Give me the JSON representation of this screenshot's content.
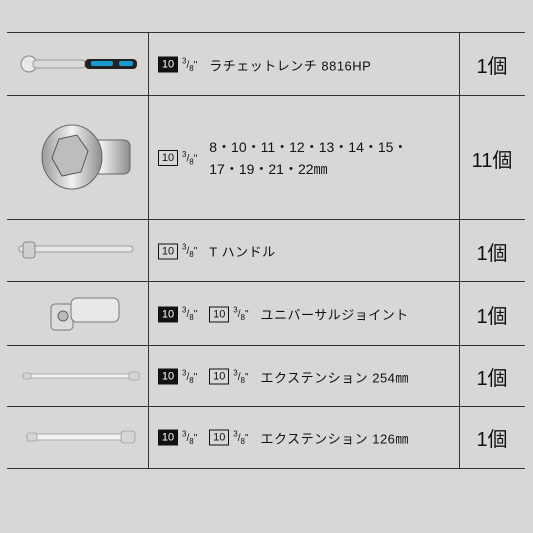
{
  "rows": [
    {
      "badges": [
        {
          "num": "10",
          "style": "solid",
          "frac_top": "3",
          "frac_bottom": "8"
        }
      ],
      "text": "ラチェットレンチ 8816HP",
      "qty": "1個",
      "image": "ratchet-wrench-icon"
    },
    {
      "badges": [
        {
          "num": "10",
          "style": "outline",
          "frac_top": "3",
          "frac_bottom": "8"
        }
      ],
      "text_lines": [
        "8・10・11・12・13・14・15・",
        "17・19・21・22㎜"
      ],
      "qty": "11個",
      "image": "socket-icon"
    },
    {
      "badges": [
        {
          "num": "10",
          "style": "outline",
          "frac_top": "3",
          "frac_bottom": "8"
        }
      ],
      "text": "T ハンドル",
      "qty": "1個",
      "image": "t-handle-icon"
    },
    {
      "badges": [
        {
          "num": "10",
          "style": "solid",
          "frac_top": "3",
          "frac_bottom": "8"
        },
        {
          "num": "10",
          "style": "outline",
          "frac_top": "3",
          "frac_bottom": "8"
        }
      ],
      "text": "ユニバーサルジョイント",
      "qty": "1個",
      "image": "universal-joint-icon"
    },
    {
      "badges": [
        {
          "num": "10",
          "style": "solid",
          "frac_top": "3",
          "frac_bottom": "8"
        },
        {
          "num": "10",
          "style": "outline",
          "frac_top": "3",
          "frac_bottom": "8"
        }
      ],
      "text": "エクステンション 254㎜",
      "qty": "1個",
      "image": "extension-long-icon"
    },
    {
      "badges": [
        {
          "num": "10",
          "style": "solid",
          "frac_top": "3",
          "frac_bottom": "8"
        },
        {
          "num": "10",
          "style": "outline",
          "frac_top": "3",
          "frac_bottom": "8"
        }
      ],
      "text": "エクステンション 126㎜",
      "qty": "1個",
      "image": "extension-short-icon"
    }
  ],
  "colors": {
    "background": "#d7d7d5",
    "border": "#333333",
    "accent_blue": "#1a9bd0"
  }
}
